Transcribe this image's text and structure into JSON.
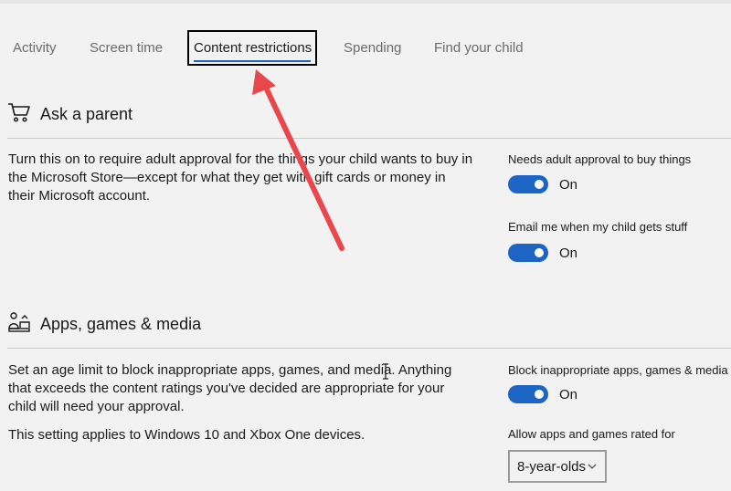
{
  "tabs": [
    {
      "label": "Activity"
    },
    {
      "label": "Screen time"
    },
    {
      "label": "Content restrictions"
    },
    {
      "label": "Spending"
    },
    {
      "label": "Find your child"
    }
  ],
  "active_tab": "Content restrictions",
  "ask_parent": {
    "title": "Ask a parent",
    "icon": "shopping-cart-icon",
    "description": "Turn this on to require adult approval for the things your child wants to buy in the Microsoft Store—except for what they get with gift cards or money in their Microsoft account.",
    "settings": [
      {
        "label": "Needs adult approval to buy things",
        "state": "On"
      },
      {
        "label": "Email me when my child gets stuff",
        "state": "On"
      }
    ]
  },
  "apps_games": {
    "title": "Apps, games & media",
    "icon": "apps-games-media-icon",
    "description": "Set an age limit to block inappropriate apps, games, and media. Anything that exceeds the content ratings you've decided are appropriate for your child will need your approval.",
    "note": "This setting applies to Windows 10 and Xbox One devices.",
    "setting": {
      "label": "Block inappropriate apps, games & media",
      "state": "On"
    },
    "age_label": "Allow apps and games rated for",
    "age_value": "8-year-olds"
  },
  "colors": {
    "accent": "#1c65c4",
    "annotation_arrow": "#e8474b"
  }
}
